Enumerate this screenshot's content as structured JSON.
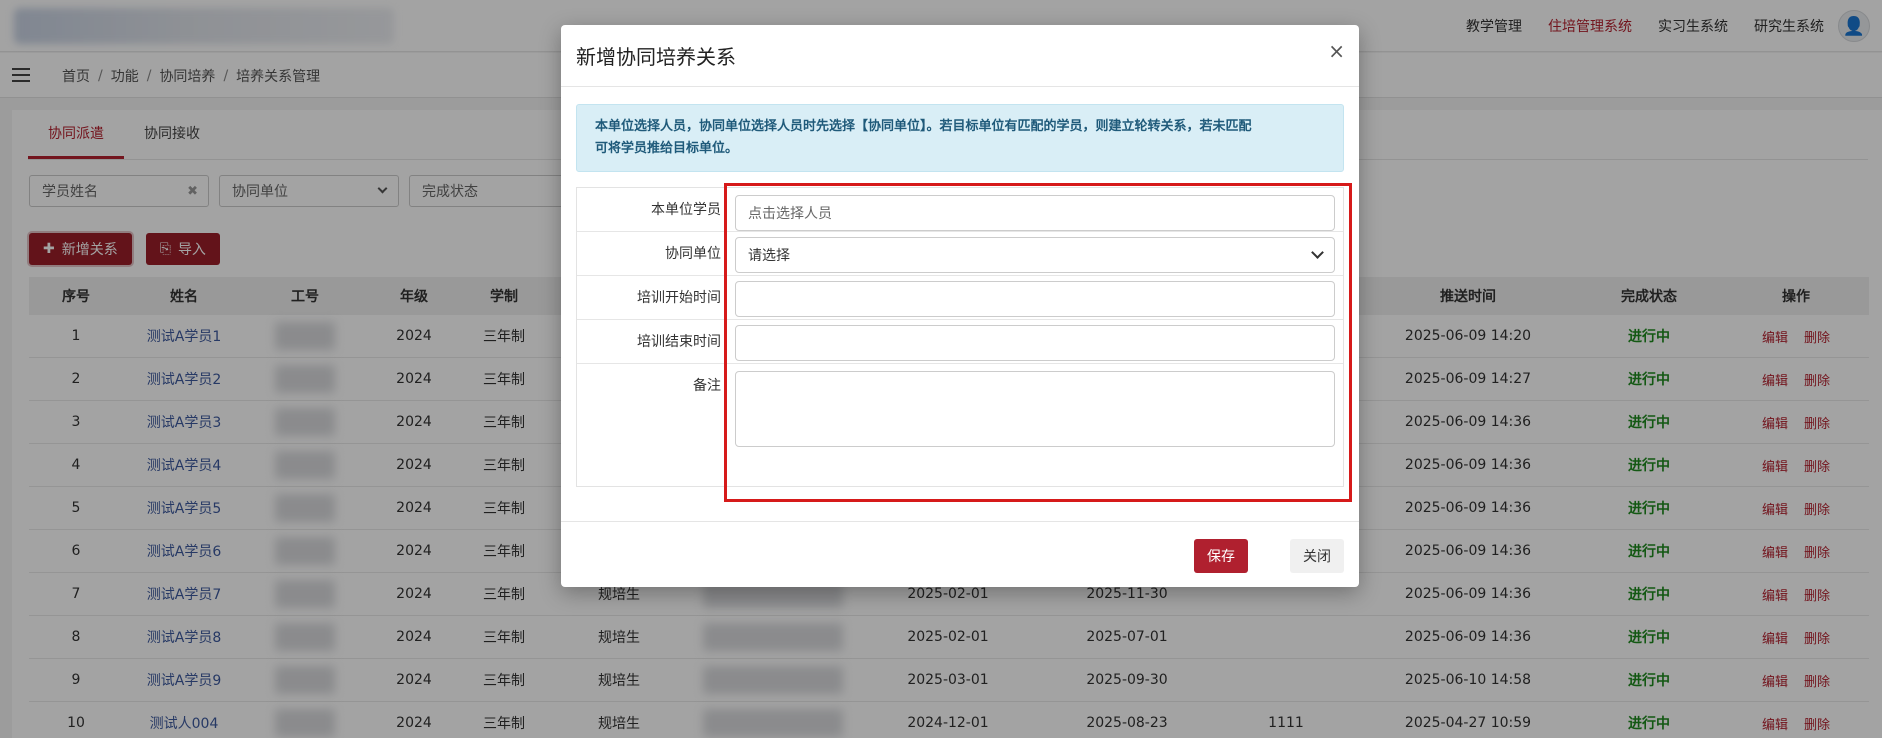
{
  "topnav": {
    "items": [
      {
        "label": "教学管理",
        "active": false
      },
      {
        "label": "住培管理系统",
        "active": true
      },
      {
        "label": "实习生系统",
        "active": false
      },
      {
        "label": "研究生系统",
        "active": false
      }
    ]
  },
  "breadcrumb": [
    "首页",
    "功能",
    "协同培养",
    "培养关系管理"
  ],
  "tabs": [
    "协同派遣",
    "协同接收"
  ],
  "filters": {
    "name_placeholder": "学员姓名",
    "unit_placeholder": "协同单位",
    "status_placeholder": "完成状态"
  },
  "actions": {
    "add_label": "新增关系",
    "import_label": "导入"
  },
  "table": {
    "columns": [
      "序号",
      "姓名",
      "工号",
      "年级",
      "学制",
      "推送时间",
      "完成状态",
      "操作"
    ],
    "op_labels": {
      "edit": "编辑",
      "delete": "删除"
    },
    "rows": [
      {
        "no": "1",
        "name": "测试A学员1",
        "grade": "2024",
        "system": "三年制",
        "type": "",
        "start": "",
        "end": "",
        "remark": "",
        "push": "2025-06-09 14:20",
        "status": "进行中"
      },
      {
        "no": "2",
        "name": "测试A学员2",
        "grade": "2024",
        "system": "三年制",
        "type": "",
        "start": "",
        "end": "",
        "remark": "",
        "push": "2025-06-09 14:27",
        "status": "进行中"
      },
      {
        "no": "3",
        "name": "测试A学员3",
        "grade": "2024",
        "system": "三年制",
        "type": "",
        "start": "",
        "end": "",
        "remark": "",
        "push": "2025-06-09 14:36",
        "status": "进行中"
      },
      {
        "no": "4",
        "name": "测试A学员4",
        "grade": "2024",
        "system": "三年制",
        "type": "",
        "start": "",
        "end": "",
        "remark": "",
        "push": "2025-06-09 14:36",
        "status": "进行中"
      },
      {
        "no": "5",
        "name": "测试A学员5",
        "grade": "2024",
        "system": "三年制",
        "type": "",
        "start": "",
        "end": "",
        "remark": "",
        "push": "2025-06-09 14:36",
        "status": "进行中"
      },
      {
        "no": "6",
        "name": "测试A学员6",
        "grade": "2024",
        "system": "三年制",
        "type": "",
        "start": "",
        "end": "",
        "remark": "",
        "push": "2025-06-09 14:36",
        "status": "进行中"
      },
      {
        "no": "7",
        "name": "测试A学员7",
        "grade": "2024",
        "system": "三年制",
        "type": "规培生",
        "start": "2025-02-01",
        "end": "2025-11-30",
        "remark": "",
        "push": "2025-06-09 14:36",
        "status": "进行中"
      },
      {
        "no": "8",
        "name": "测试A学员8",
        "grade": "2024",
        "system": "三年制",
        "type": "规培生",
        "start": "2025-02-01",
        "end": "2025-07-01",
        "remark": "",
        "push": "2025-06-09 14:36",
        "status": "进行中"
      },
      {
        "no": "9",
        "name": "测试A学员9",
        "grade": "2024",
        "system": "三年制",
        "type": "规培生",
        "start": "2025-03-01",
        "end": "2025-09-30",
        "remark": "",
        "push": "2025-06-10 14:58",
        "status": "进行中"
      },
      {
        "no": "10",
        "name": "测试人004",
        "grade": "2024",
        "system": "三年制",
        "type": "规培生",
        "start": "2024-12-01",
        "end": "2025-08-23",
        "remark": "1111",
        "push": "2025-04-27 10:59",
        "status": "进行中"
      }
    ]
  },
  "modal": {
    "title": "新增协同培养关系",
    "close_glyph": "×",
    "alert_line1": "本单位选择人员，协同单位选择人员时先选择【协同单位】。若目标单位有匹配的学员，则建立轮转关系，若未匹配",
    "alert_line2": "可将学员推给目标单位。",
    "fields": {
      "student_label": "本单位学员",
      "student_placeholder": "点击选择人员",
      "unit_label": "协同单位",
      "unit_value": "请选择",
      "start_label": "培训开始时间",
      "start_value": "",
      "end_label": "培训结束时间",
      "end_value": "",
      "remark_label": "备注",
      "remark_value": ""
    },
    "save_label": "保存",
    "close_label": "关闭"
  }
}
